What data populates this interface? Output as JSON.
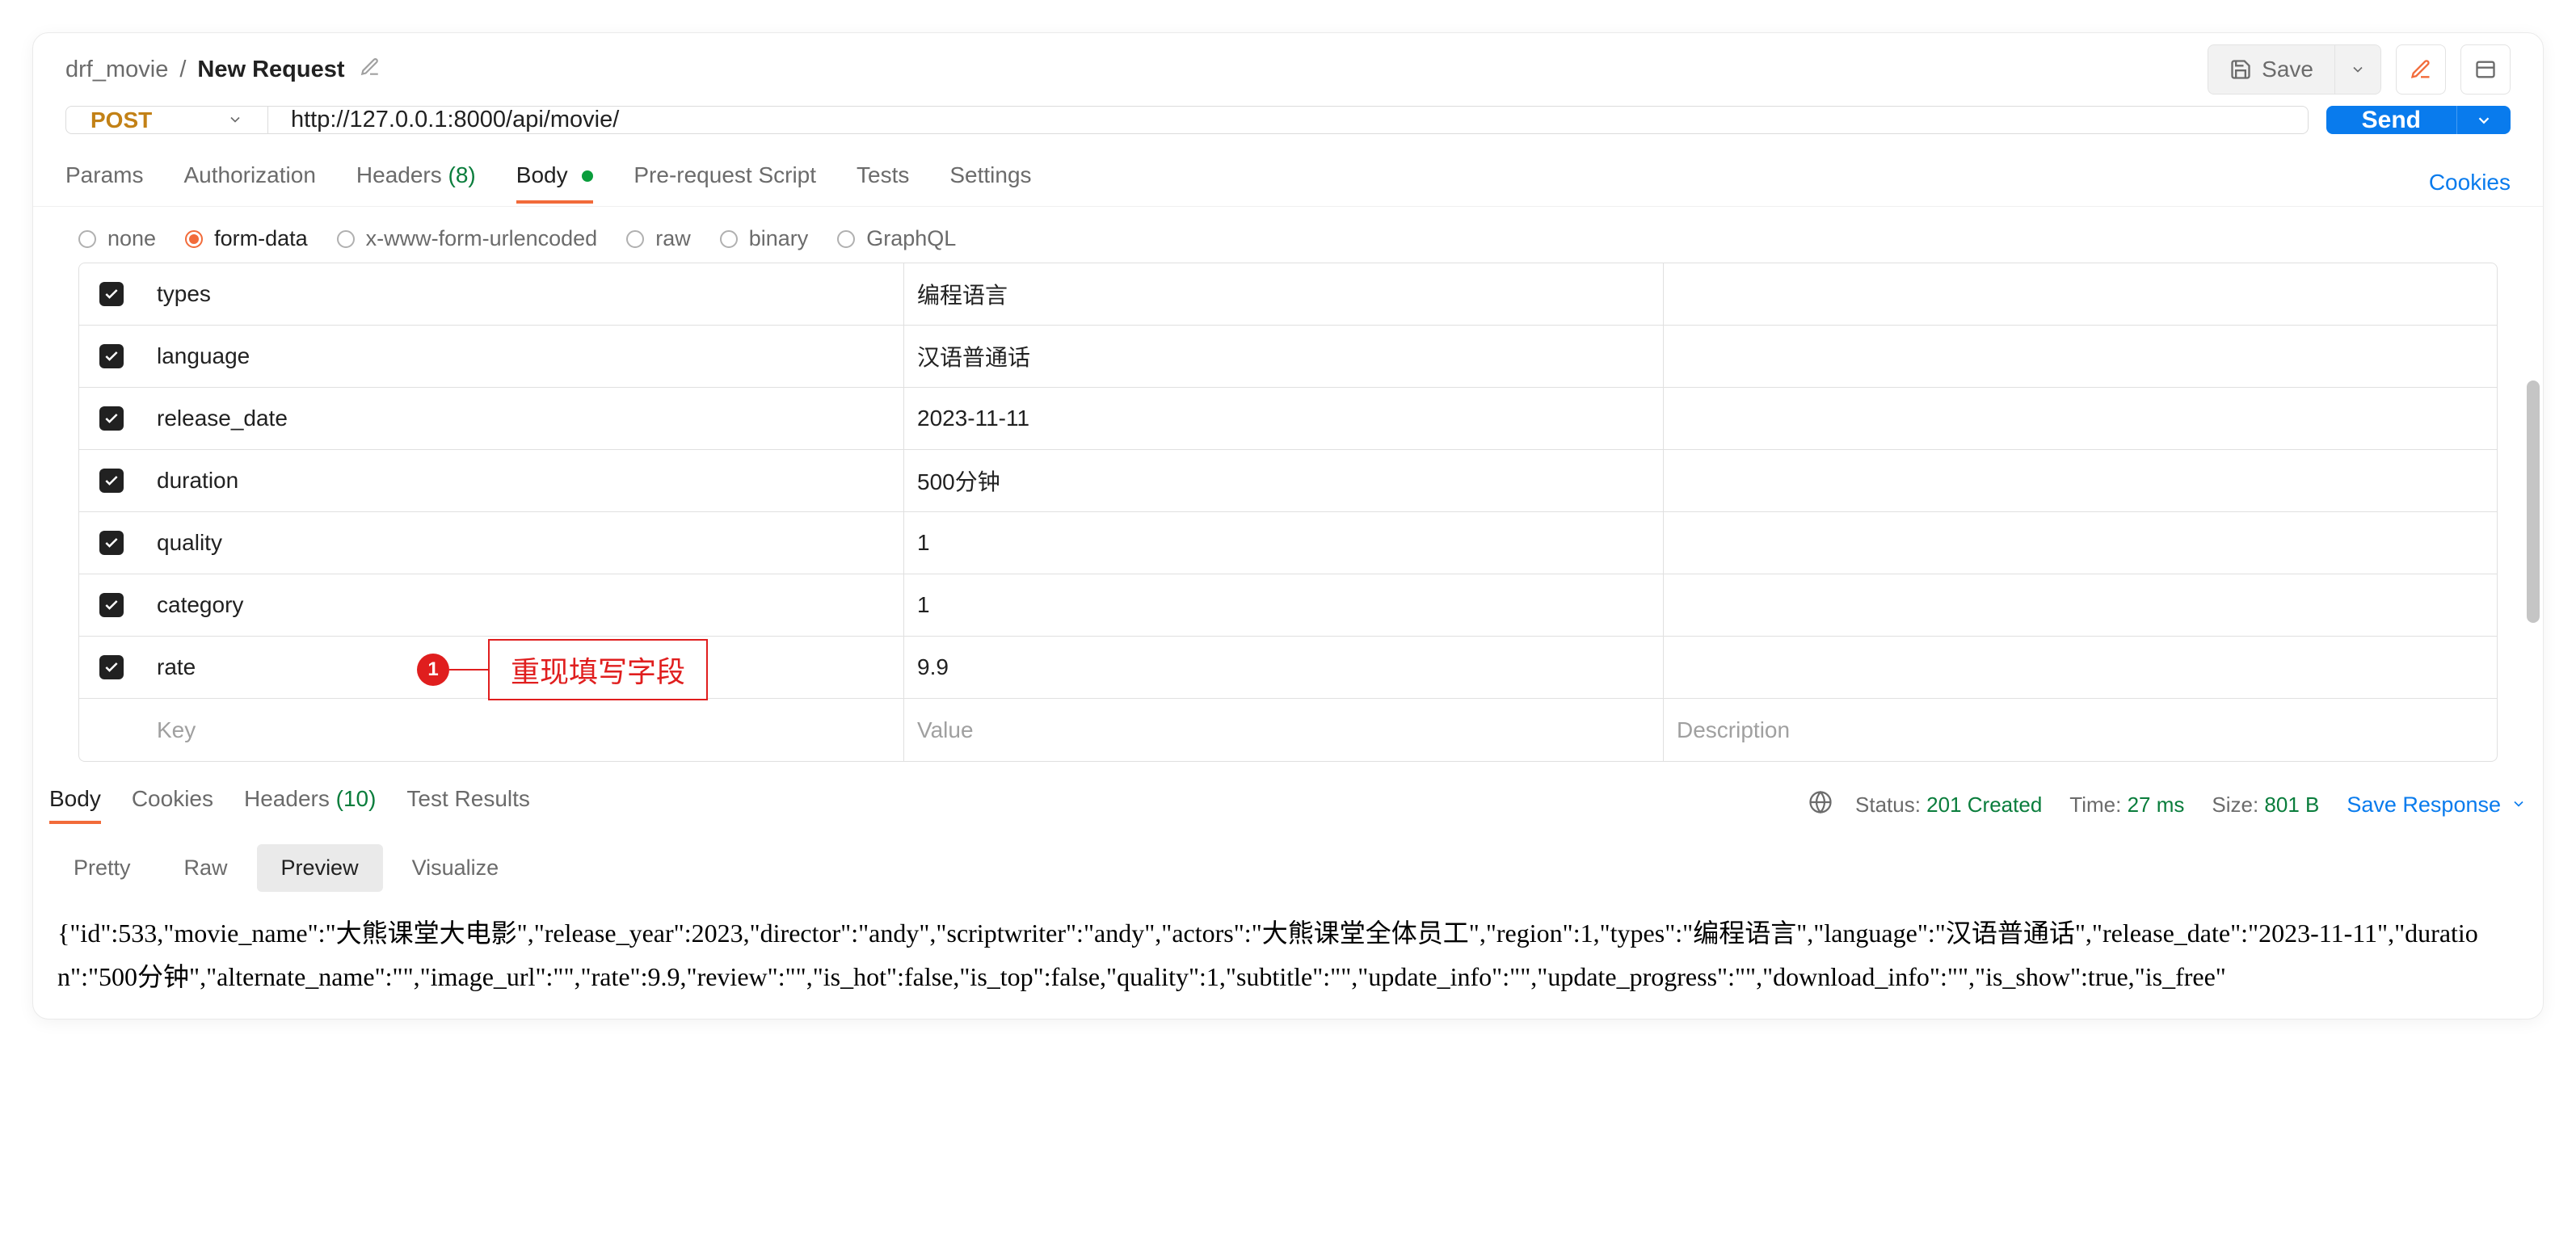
{
  "breadcrumb": {
    "parent": "drf_movie",
    "current": "New Request"
  },
  "header_actions": {
    "save_label": "Save"
  },
  "request": {
    "method": "POST",
    "url": "http://127.0.0.1:8000/api/movie/",
    "send_label": "Send"
  },
  "tabs": {
    "params": "Params",
    "authorization": "Authorization",
    "headers": "Headers",
    "headers_count": "(8)",
    "body": "Body",
    "pre_request": "Pre-request Script",
    "tests": "Tests",
    "settings": "Settings",
    "cookies_link": "Cookies"
  },
  "body_types": {
    "none": "none",
    "form_data": "form-data",
    "x_www": "x-www-form-urlencoded",
    "raw": "raw",
    "binary": "binary",
    "graphql": "GraphQL"
  },
  "form_data": {
    "rows": [
      {
        "key": "types",
        "value": "编程语言"
      },
      {
        "key": "language",
        "value": "汉语普通话"
      },
      {
        "key": "release_date",
        "value": "2023-11-11"
      },
      {
        "key": "duration",
        "value": "500分钟"
      },
      {
        "key": "quality",
        "value": "1"
      },
      {
        "key": "category",
        "value": "1"
      },
      {
        "key": "rate",
        "value": "9.9"
      }
    ],
    "placeholder_key": "Key",
    "placeholder_value": "Value",
    "placeholder_desc": "Description"
  },
  "annotation": {
    "number": "1",
    "text": "重现填写字段"
  },
  "response_tabs": {
    "body": "Body",
    "cookies": "Cookies",
    "headers": "Headers",
    "headers_count": "(10)",
    "test_results": "Test Results"
  },
  "response_meta": {
    "status_label": "Status:",
    "status_value": "201 Created",
    "time_label": "Time:",
    "time_value": "27 ms",
    "size_label": "Size:",
    "size_value": "801 B",
    "save_response": "Save Response"
  },
  "view_modes": {
    "pretty": "Pretty",
    "raw": "Raw",
    "preview": "Preview",
    "visualize": "Visualize"
  },
  "response_body": "{\"id\":533,\"movie_name\":\"大熊课堂大电影\",\"release_year\":2023,\"director\":\"andy\",\"scriptwriter\":\"andy\",\"actors\":\"大熊课堂全体员工\",\"region\":1,\"types\":\"编程语言\",\"language\":\"汉语普通话\",\"release_date\":\"2023-11-11\",\"duration\":\"500分钟\",\"alternate_name\":\"\",\"image_url\":\"\",\"rate\":9.9,\"review\":\"\",\"is_hot\":false,\"is_top\":false,\"quality\":1,\"subtitle\":\"\",\"update_info\":\"\",\"update_progress\":\"\",\"download_info\":\"\",\"is_show\":true,\"is_free\""
}
